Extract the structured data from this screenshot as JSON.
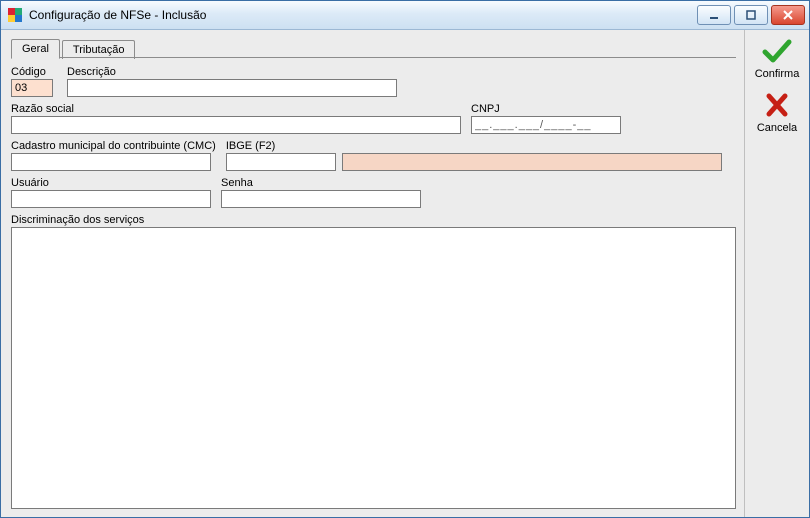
{
  "window": {
    "title": "Configuração de NFSe - Inclusão"
  },
  "tabs": {
    "geral": "Geral",
    "tributacao": "Tributação"
  },
  "labels": {
    "codigo": "Código",
    "descricao": "Descrição",
    "razao": "Razão social",
    "cnpj": "CNPJ",
    "cmc": "Cadastro municipal do contribuinte (CMC)",
    "ibge": "IBGE (F2)",
    "usuario": "Usuário",
    "senha": "Senha",
    "discr": "Discriminação dos serviços"
  },
  "values": {
    "codigo": "03",
    "descricao": "",
    "razao": "",
    "cnpj": "__.___.___/____-__",
    "cmc": "",
    "ibge": "",
    "ibge_desc": "",
    "usuario": "",
    "senha": "",
    "discr": ""
  },
  "side": {
    "confirma": "Confirma",
    "cancela": "Cancela"
  }
}
